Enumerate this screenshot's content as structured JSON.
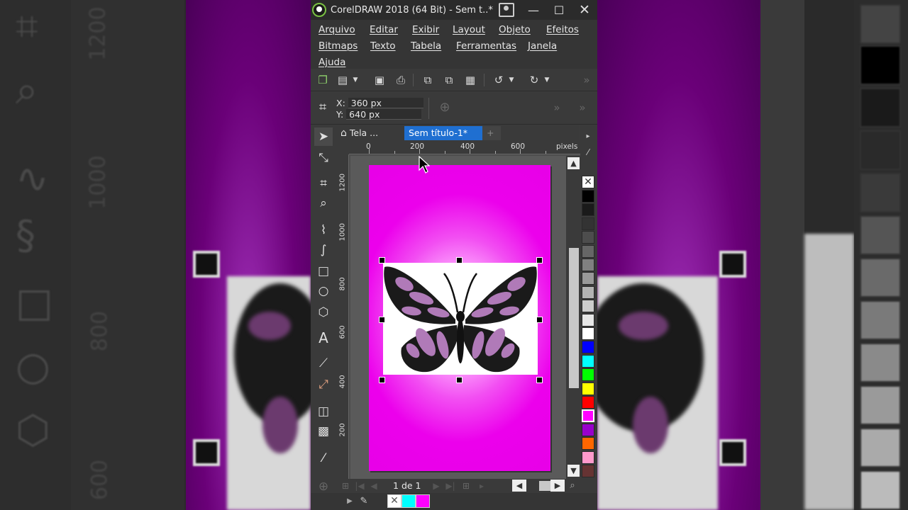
{
  "window": {
    "title": "CorelDRAW 2018 (64 Bit) - Sem t..*",
    "minimize": "—",
    "maximize": "☐",
    "close": "✕"
  },
  "menu": {
    "row1": [
      "Arquivo",
      "Editar",
      "Exibir",
      "Layout",
      "Objeto",
      "Efeitos"
    ],
    "row2": [
      "Bitmaps",
      "Texto",
      "Tabela",
      "Ferramentas",
      "Janela"
    ],
    "row3": [
      "Ajuda"
    ]
  },
  "property_bar": {
    "x_label": "X:",
    "x_value": "360 px",
    "y_label": "Y:",
    "y_value": "640 px"
  },
  "tabs": {
    "welcome": "Tela ...",
    "document": "Sem título-1*",
    "add": "+"
  },
  "ruler": {
    "h_labels": [
      "0",
      "200",
      "400",
      "600"
    ],
    "h_unit": "pixels",
    "v_labels": [
      "1200",
      "1000",
      "800",
      "600",
      "400",
      "200"
    ]
  },
  "pager": {
    "current": "1",
    "of_label": "de",
    "total": "1"
  },
  "palette": {
    "colors": [
      "#000000",
      "#1a1a1a",
      "#333333",
      "#4d4d4d",
      "#666666",
      "#808080",
      "#999999",
      "#b3b3b3",
      "#cccccc",
      "#e6e6e6",
      "#ffffff",
      "#0000ff",
      "#00ffff",
      "#00ff00",
      "#ffff00",
      "#ff0000",
      "#ff00ff",
      "#9900cc",
      "#ff6600",
      "#ff99cc",
      "#663333"
    ]
  },
  "fill_indicators": {
    "outline": "none",
    "fill1": "#00ffff",
    "fill2": "#ff00ff"
  },
  "colors": {
    "accent_tab": "#1f6fd1",
    "page_magenta": "#e600e6"
  }
}
